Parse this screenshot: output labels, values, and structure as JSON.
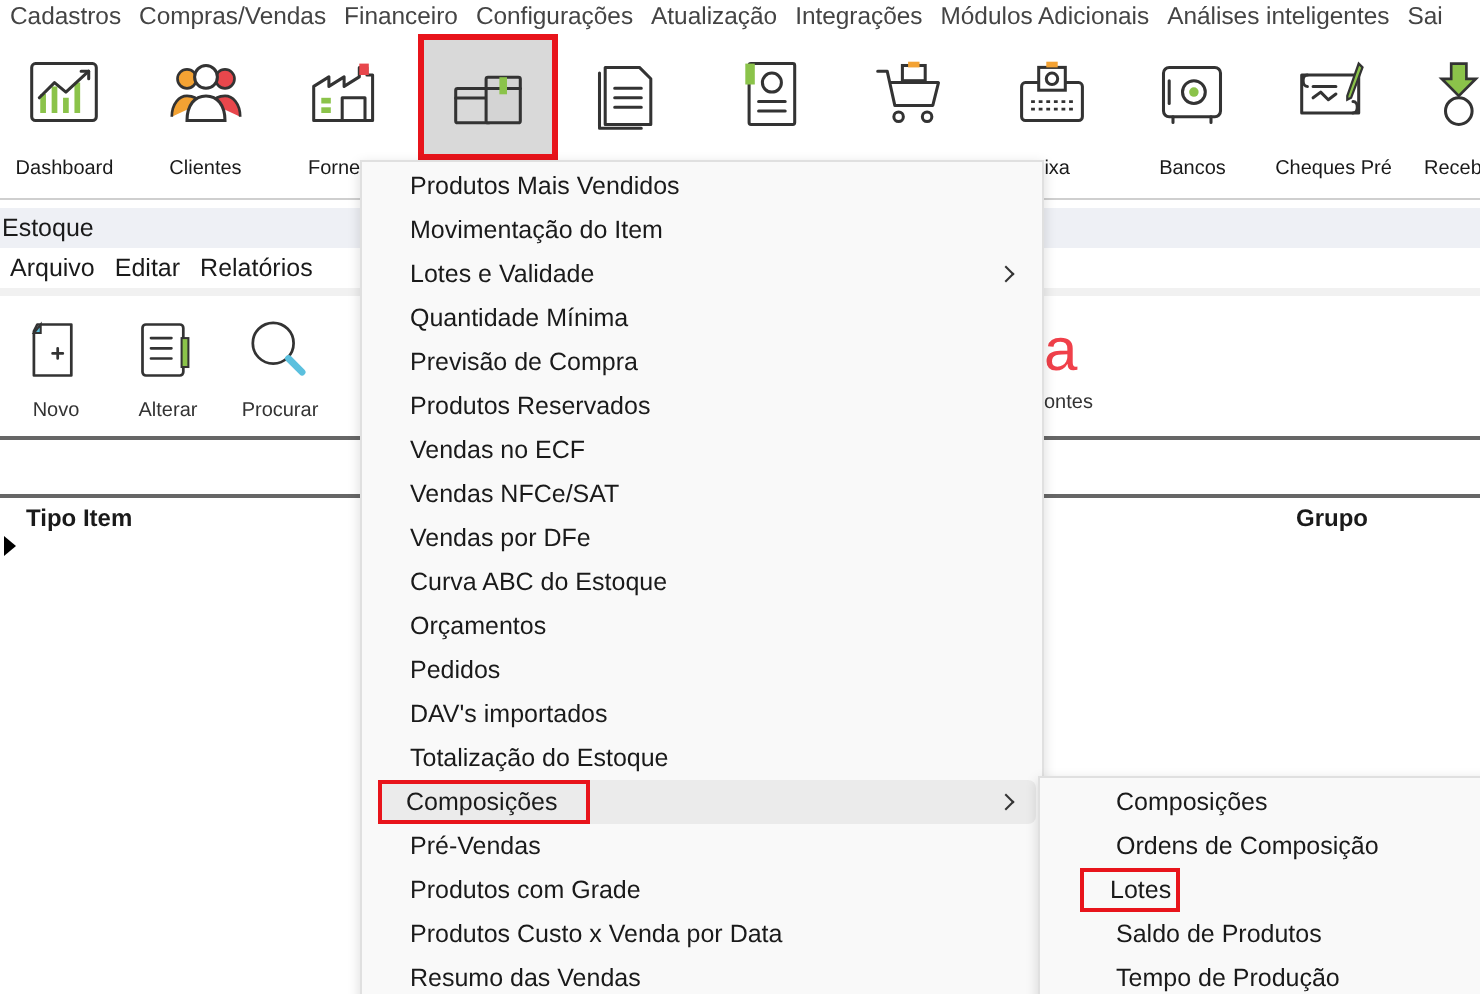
{
  "menubar": [
    "Cadastros",
    "Compras/Vendas",
    "Financeiro",
    "Configurações",
    "Atualização",
    "Integrações",
    "Módulos Adicionais",
    "Análises inteligentes",
    "Sai"
  ],
  "toolbar": [
    {
      "label": "Dashboard",
      "selected": false,
      "highlighted": false
    },
    {
      "label": "Clientes",
      "selected": false,
      "highlighted": false
    },
    {
      "label": "Forne",
      "selected": false,
      "highlighted": false
    },
    {
      "selected": true,
      "highlighted": true
    },
    {
      "selected": false,
      "highlighted": false
    },
    {
      "selected": false,
      "highlighted": false
    },
    {
      "selected": false,
      "highlighted": false
    },
    {
      "label": "ixa",
      "selected": false,
      "highlighted": false
    },
    {
      "label": "Bancos",
      "selected": false,
      "highlighted": false
    },
    {
      "label": "Cheques Pré",
      "selected": false,
      "highlighted": false
    },
    {
      "label": "Receb",
      "selected": false,
      "highlighted": false
    }
  ],
  "window": {
    "title": "Estoque",
    "menus": [
      "Arquivo",
      "Editar",
      "Relatórios"
    ],
    "tools": [
      {
        "label": "Novo"
      },
      {
        "label": "Alterar"
      },
      {
        "label": "Procurar"
      }
    ],
    "fonts_tool": {
      "glyph": "a",
      "label": "ontes"
    },
    "table": {
      "columns": [
        "Tipo Item",
        "Grupo"
      ],
      "current_row": true
    }
  },
  "dropdown": {
    "items": [
      {
        "label": "Produtos Mais Vendidos",
        "submenu": false,
        "hovered": false,
        "highlighted": false
      },
      {
        "label": "Movimentação do Item",
        "submenu": false,
        "hovered": false,
        "highlighted": false
      },
      {
        "label": "Lotes e Validade",
        "submenu": true,
        "hovered": false,
        "highlighted": false
      },
      {
        "label": "Quantidade Mínima",
        "submenu": false,
        "hovered": false,
        "highlighted": false
      },
      {
        "label": "Previsão de Compra",
        "submenu": false,
        "hovered": false,
        "highlighted": false
      },
      {
        "label": "Produtos Reservados",
        "submenu": false,
        "hovered": false,
        "highlighted": false
      },
      {
        "label": "Vendas no ECF",
        "submenu": false,
        "hovered": false,
        "highlighted": false
      },
      {
        "label": "Vendas NFCe/SAT",
        "submenu": false,
        "hovered": false,
        "highlighted": false
      },
      {
        "label": "Vendas por DFe",
        "submenu": false,
        "hovered": false,
        "highlighted": false
      },
      {
        "label": "Curva ABC do Estoque",
        "submenu": false,
        "hovered": false,
        "highlighted": false
      },
      {
        "label": "Orçamentos",
        "submenu": false,
        "hovered": false,
        "highlighted": false
      },
      {
        "label": "Pedidos",
        "submenu": false,
        "hovered": false,
        "highlighted": false
      },
      {
        "label": "DAV's importados",
        "submenu": false,
        "hovered": false,
        "highlighted": false
      },
      {
        "label": "Totalização do Estoque",
        "submenu": false,
        "hovered": false,
        "highlighted": false
      },
      {
        "label": "Composições",
        "submenu": true,
        "hovered": true,
        "highlighted": true
      },
      {
        "label": "Pré-Vendas",
        "submenu": false,
        "hovered": false,
        "highlighted": false
      },
      {
        "label": "Produtos com Grade",
        "submenu": false,
        "hovered": false,
        "highlighted": false
      },
      {
        "label": "Produtos Custo x Venda por Data",
        "submenu": false,
        "hovered": false,
        "highlighted": false
      },
      {
        "label": "Resumo das Vendas",
        "submenu": false,
        "hovered": false,
        "highlighted": false
      }
    ]
  },
  "submenu": {
    "items": [
      {
        "label": "Composições",
        "highlighted": false
      },
      {
        "label": "Ordens de Composição",
        "highlighted": false
      },
      {
        "label": "Lotes",
        "highlighted": true
      },
      {
        "label": "Saldo de Produtos",
        "highlighted": false
      },
      {
        "label": "Tempo de Produção",
        "highlighted": false
      }
    ]
  }
}
